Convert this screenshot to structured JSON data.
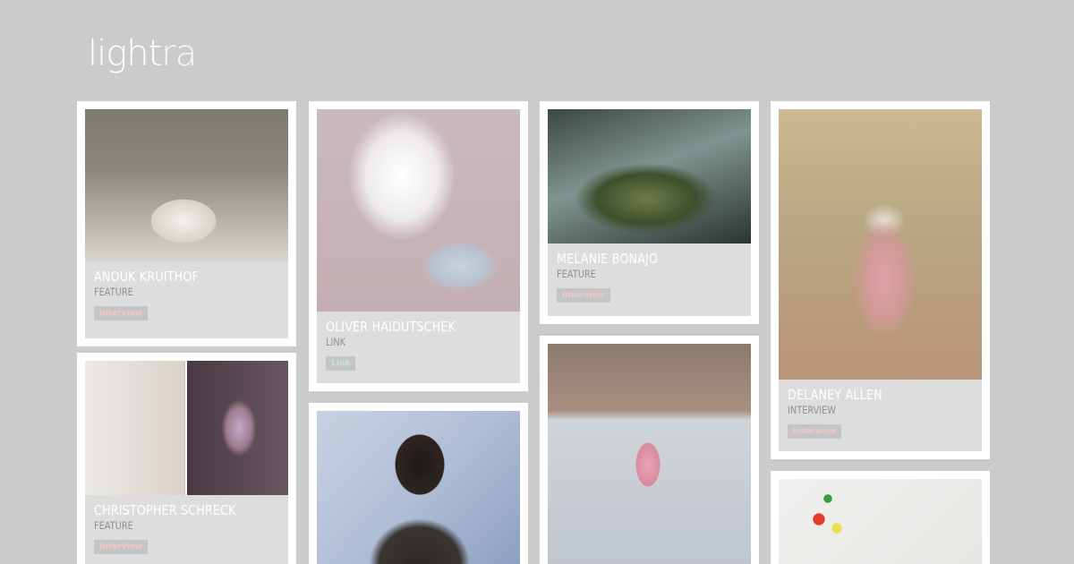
{
  "brand": {
    "logo_main": "light",
    "logo_accent": "ra"
  },
  "colors": {
    "background": "#cbcbcb",
    "card": "#ffffff",
    "meta_panel": "#dddddd",
    "interview_tag": "#f2c7c7",
    "link_tag": "#bfe6d2"
  },
  "posts": [
    {
      "name": "ANOUK KRUITHOF",
      "category": "FEATURE",
      "tag": "Interview",
      "image_icon": "hands-circle-photo"
    },
    {
      "name": "OLIVER HAIDUTSCHEK",
      "category": "LINK",
      "tag": "Link",
      "image_icon": "smoke-bracelet-photo"
    },
    {
      "name": "MELANIE BONAJO",
      "category": "FEATURE",
      "tag": "Interview",
      "image_icon": "car-flowers-photo"
    },
    {
      "name": "DELANEY ALLEN",
      "category": "INTERVIEW",
      "tag": "Interview",
      "image_icon": "blurred-figure-photo"
    },
    {
      "name": "CHRISTOPHER SCHRECK",
      "category": "FEATURE",
      "tag": "Interview",
      "image_icon": "foam-crystal-photo"
    },
    {
      "name": "",
      "category": "",
      "tag": "",
      "image_icon": "portrait-photo"
    },
    {
      "name": "",
      "category": "",
      "tag": "",
      "image_icon": "frozen-lake-photo"
    },
    {
      "name": "",
      "category": "",
      "tag": "",
      "image_icon": "branch-photo"
    }
  ]
}
